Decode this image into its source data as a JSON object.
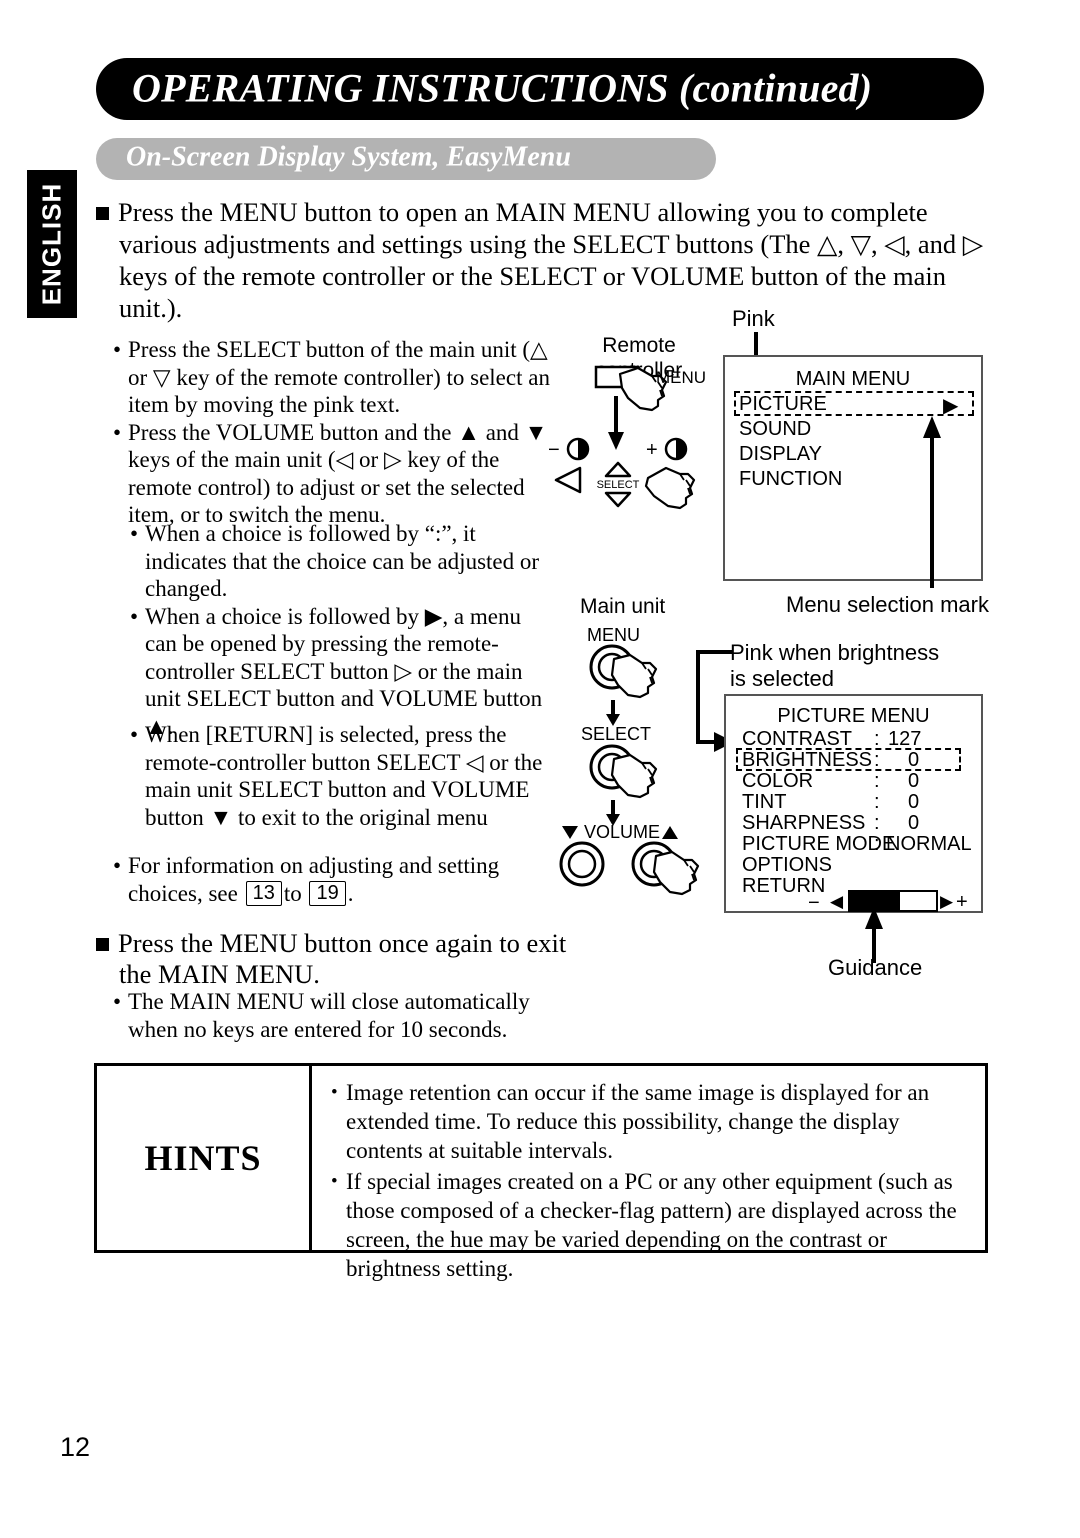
{
  "header": {
    "title": "OPERATING INSTRUCTIONS (continued)",
    "subtitle": "On-Screen Display System, EasyMenu",
    "language_tab": "ENGLISH"
  },
  "body": {
    "para1": "Press the MENU button to open an MAIN MENU allowing you to complete various adjustments and settings using the SELECT buttons (The △, ▽, ◁, and ▷ keys of the remote controller or the SELECT or VOLUME button of the main unit.).",
    "group1": [
      "Press the SELECT button of the main unit (△ or ▽ key of the remote controller) to select an item by moving the pink text.",
      "Press the VOLUME button and the ▲ and ▼ keys of the main unit (◁ or ▷ key of the remote control) to adjust or set the selected item, or to switch the menu."
    ],
    "group2": [
      "When a choice is followed by “:”, it indicates that the choice can be adjusted or changed.",
      "When a choice is followed by ▶, a menu can be opened by pressing the remote-controller SELECT button ▷ or the main unit SELECT button and VOLUME button ▲."
    ],
    "group3": [
      "When [RETURN] is selected, press the remote-controller button SELECT ◁ or the main unit SELECT button and VOLUME button ▼ to exit to the original menu"
    ],
    "group4_prefix": "For information on adjusting and setting choices, see",
    "group4_page_from": "13",
    "group4_page_mid": "to",
    "group4_page_to": "19",
    "group4_suffix": ".",
    "para2": "Press the MENU button once again to exit the MAIN MENU.",
    "group5": [
      "The MAIN MENU will close automatically when no keys are entered for 10 seconds."
    ]
  },
  "hints": {
    "label": "HINTS",
    "items": [
      "Image retention can occur if the same image is displayed for an extended time. To reduce this possibility, change the display contents at suitable intervals.",
      "If special images created on a PC or any other equipment (such as those composed of a checker-flag pattern) are displayed across the screen, the hue may be varied depending on the contrast or brightness setting."
    ]
  },
  "diagram": {
    "remote_label_line1": "Remote",
    "remote_label_line2": "controller",
    "remote_menu_label": "MENU",
    "remote_select_label": "SELECT",
    "remote_minus": "−",
    "remote_plus": "+",
    "main_unit_label": "Main unit",
    "main_menu_btn": "MENU",
    "main_select_btn": "SELECT",
    "main_volume_btn": "VOLUME",
    "callout_pink": "Pink",
    "callout_menu_selection_mark": "Menu selection mark",
    "callout_pink_brightness_l1": "Pink when brightness",
    "callout_pink_brightness_l2": "is selected",
    "callout_guidance": "Guidance"
  },
  "main_menu_osd": {
    "title": "MAIN MENU",
    "items": [
      {
        "label": "PICTURE",
        "mark": "▶",
        "selected": true
      },
      {
        "label": "SOUND",
        "mark": "",
        "selected": false
      },
      {
        "label": "DISPLAY",
        "mark": "",
        "selected": false
      },
      {
        "label": "FUNCTION",
        "mark": "",
        "selected": false
      }
    ]
  },
  "picture_menu_osd": {
    "title": "PICTURE MENU",
    "rows": [
      {
        "label": "CONTRAST",
        "sep": ":",
        "value": "127",
        "selected": false
      },
      {
        "label": "BRIGHTNESS",
        "sep": ":",
        "value": "0",
        "selected": true
      },
      {
        "label": "COLOR",
        "sep": ":",
        "value": "0",
        "selected": false
      },
      {
        "label": "TINT",
        "sep": ":",
        "value": "0",
        "selected": false
      },
      {
        "label": "SHARPNESS",
        "sep": ":",
        "value": "0",
        "selected": false
      },
      {
        "label": "PICTURE MODE",
        "sep": ":",
        "value": "NORMAL",
        "selected": false
      },
      {
        "label": "OPTIONS",
        "sep": "",
        "value": "",
        "selected": false
      },
      {
        "label": "RETURN",
        "sep": "",
        "value": "",
        "selected": false
      }
    ],
    "guidance_minus": "−",
    "guidance_plus": "+",
    "guidance_left_arrow": "◀",
    "guidance_right_arrow": "▶",
    "guidance_fill_percent": 58
  },
  "page_number": "12"
}
